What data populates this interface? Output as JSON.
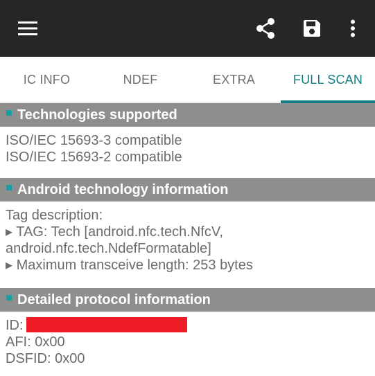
{
  "colors": {
    "appbar": "#262626",
    "accent": "#127d80",
    "section_header": "#8e8e8e",
    "bullet": "#13a1a6",
    "redaction": "#ee1c24"
  },
  "appbar": {
    "icons": [
      "menu-icon",
      "share-icon",
      "save-icon",
      "more-vert-icon"
    ]
  },
  "tabs": [
    {
      "label": "IC INFO",
      "active": false
    },
    {
      "label": "NDEF",
      "active": false
    },
    {
      "label": "EXTRA",
      "active": false
    },
    {
      "label": "FULL SCAN",
      "active": true
    }
  ],
  "sections": [
    {
      "title": "Technologies supported",
      "lines": [
        "ISO/IEC 15693-3 compatible",
        "ISO/IEC 15693-2 compatible"
      ]
    },
    {
      "title": "Android technology information",
      "lines": [
        "Tag description:",
        "▸ TAG: Tech [android.nfc.tech.NfcV,",
        "android.nfc.tech.NdefFormatable]",
        "▸ Maximum transceive length: 253 bytes"
      ]
    },
    {
      "title": "Detailed protocol information",
      "id_label": "ID:",
      "lines": [
        "AFI: 0x00",
        "DSFID: 0x00"
      ]
    }
  ]
}
